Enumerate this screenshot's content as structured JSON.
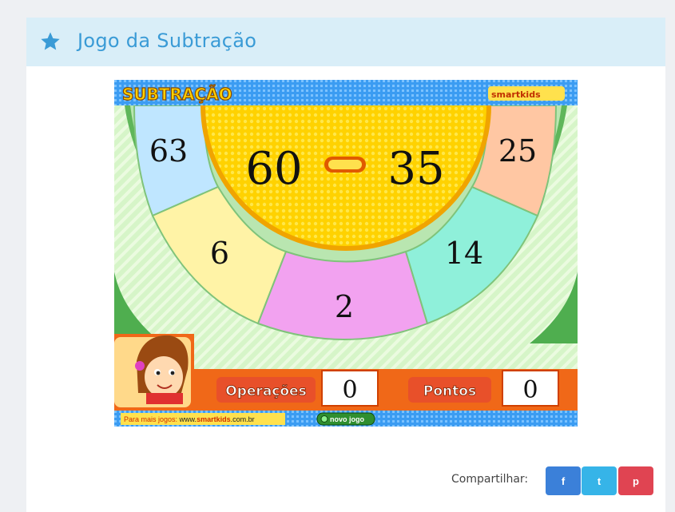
{
  "header": {
    "title": "Jogo da Subtração"
  },
  "game": {
    "title": "SUBTRAÇÃO",
    "logo": "smartkids",
    "question": {
      "left": "60",
      "right": "35"
    },
    "answers": [
      "63",
      "6",
      "2",
      "14",
      "25"
    ],
    "operacoes_label": "Operações",
    "operacoes_value": "0",
    "pontos_label": "Pontos",
    "pontos_value": "0",
    "footer_text": "Para mais jogos:",
    "footer_site_prefix": "www.",
    "footer_site_brand": "smartkids",
    "footer_site_suffix": ".com.br",
    "new_game_label": "novo jogo"
  },
  "share": {
    "label": "Compartilhar:",
    "facebook": "f",
    "twitter": "t",
    "pinterest": "p"
  },
  "colors": {
    "accent": "#3a9bd6",
    "header_bg": "#d9eef8",
    "facebook": "#3b80d9",
    "twitter": "#36b4e8",
    "pinterest": "#e04452"
  }
}
